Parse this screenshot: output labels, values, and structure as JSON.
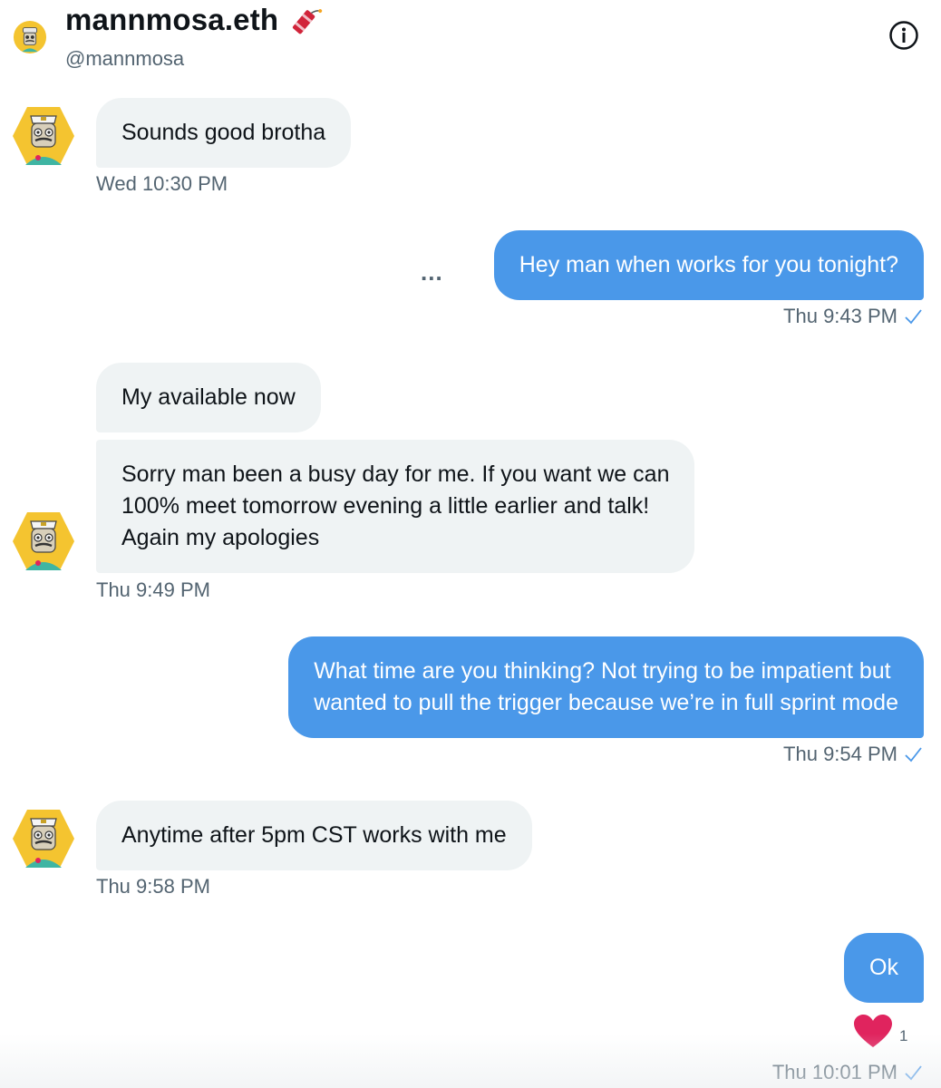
{
  "header": {
    "name": "mannmosa.eth",
    "handle": "@mannmosa",
    "name_emoji": "firecracker-icon",
    "info_icon": "info-icon"
  },
  "colors": {
    "outgoing_bubble": "#4a98e9",
    "incoming_bubble": "#eff3f4",
    "timestamp": "#536471",
    "heart": "#e0245e",
    "avatar_bg": "#f4c430"
  },
  "messages": [
    {
      "direction": "incoming",
      "text": "Sounds good brotha",
      "timestamp": "Wed 10:30 PM"
    },
    {
      "direction": "outgoing",
      "text": "Hey man when works for you tonight?",
      "timestamp": "Thu 9:43 PM"
    },
    {
      "direction": "incoming",
      "text": "My available now"
    },
    {
      "direction": "incoming",
      "lines": [
        "Sorry man been a busy day for me. If you want we can",
        "100% meet tomorrow evening a little earlier and talk!",
        "Again my apologies"
      ],
      "timestamp": "Thu 9:49 PM"
    },
    {
      "direction": "outgoing",
      "lines": [
        "What time are you thinking? Not trying to be impatient but",
        "wanted to pull the trigger because we’re in full sprint mode"
      ],
      "timestamp": "Thu 9:54 PM"
    },
    {
      "direction": "incoming",
      "text": "Anytime after 5pm CST works with me",
      "timestamp": "Thu 9:58 PM"
    },
    {
      "direction": "outgoing",
      "text": "Ok",
      "timestamp": "Thu 10:01 PM",
      "reaction": {
        "icon": "heart-icon",
        "count": "1"
      }
    }
  ],
  "typing_indicator": "..."
}
